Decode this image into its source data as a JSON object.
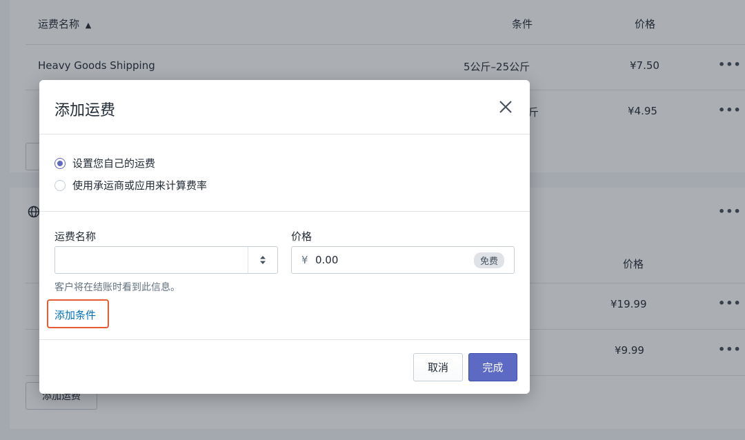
{
  "table": {
    "headers": {
      "name": "运费名称",
      "sort_indicator": "▲",
      "condition": "条件",
      "price": "价格"
    },
    "rows": [
      {
        "name": "Heavy Goods Shipping",
        "condition": "5公斤–25公斤",
        "price": "¥7.50",
        "more": "•••"
      },
      {
        "name": "",
        "condition": "斤",
        "price": "¥4.95",
        "more": "•••"
      }
    ]
  },
  "zone2": {
    "more": "•••",
    "price_header": "价格",
    "rows": [
      {
        "price": "¥19.99",
        "more": "•••"
      },
      {
        "price": "¥9.99",
        "more": "•••"
      }
    ],
    "add_rate_label": "添加运费"
  },
  "modal": {
    "title": "添加运费",
    "close_icon": "close-icon",
    "options": [
      {
        "label": "设置您自己的运费",
        "checked": true
      },
      {
        "label": "使用承运商或应用来计算费率",
        "checked": false
      }
    ],
    "name_field": {
      "label": "运费名称",
      "value": ""
    },
    "price_field": {
      "label": "价格",
      "currency": "¥",
      "value": "0.00",
      "badge": "免费"
    },
    "help_text": "客户将在结账时看到此信息。",
    "add_condition": "添加条件",
    "cancel_label": "取消",
    "done_label": "完成"
  },
  "colors": {
    "primary": "#5c6ac4",
    "link": "#006fbb",
    "highlight": "#e8592f"
  }
}
